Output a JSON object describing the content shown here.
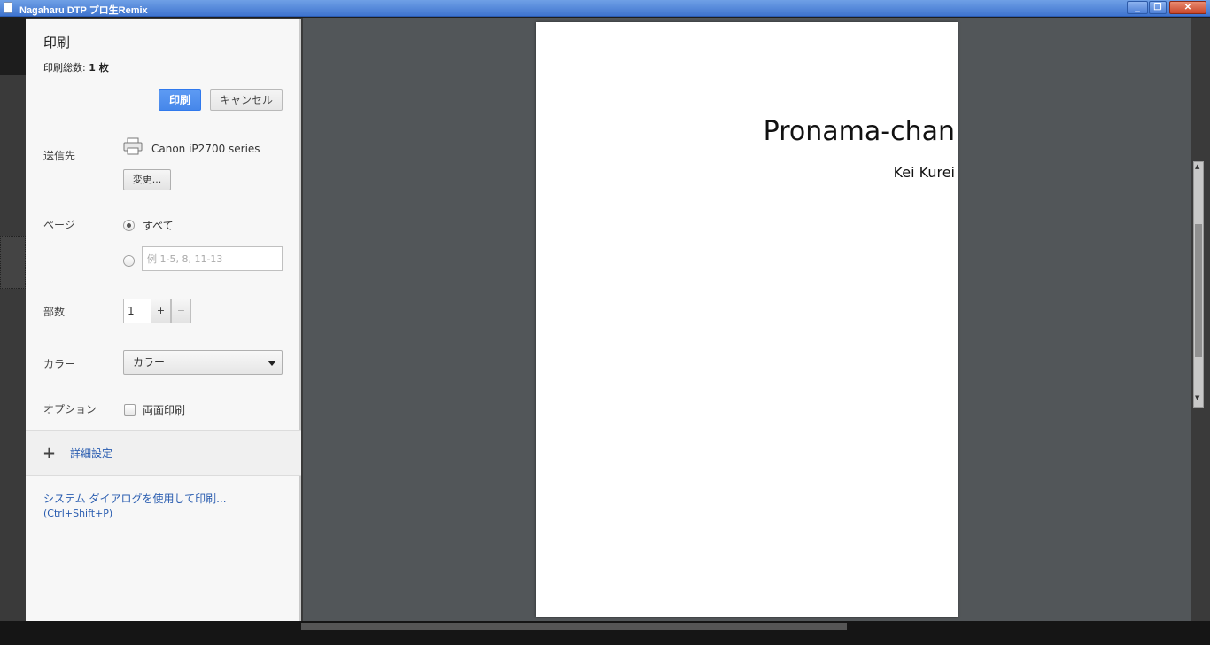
{
  "window": {
    "title": "Nagaharu DTP プロ生Remix",
    "minimize": "_",
    "restore": "❐",
    "close": "✕"
  },
  "print": {
    "title": "印刷",
    "total_label": "印刷総数:",
    "total_value": "1 枚",
    "print_button": "印刷",
    "cancel_button": "キャンセル"
  },
  "destination": {
    "label": "送信先",
    "printer_name": "Canon iP2700 series",
    "printer_icon": "printer-icon",
    "change_button": "変更..."
  },
  "pages": {
    "label": "ページ",
    "all_label": "すべて",
    "all_selected": true,
    "range_placeholder": "例 1-5, 8, 11-13"
  },
  "copies": {
    "label": "部数",
    "value": "1",
    "plus": "+",
    "minus": "−"
  },
  "color": {
    "label": "カラー",
    "selected": "カラー"
  },
  "options": {
    "label": "オプション",
    "duplex_label": "両面印刷",
    "duplex_checked": false
  },
  "advanced": {
    "icon": "+",
    "label": "詳細設定"
  },
  "system_dialog": {
    "label": "システム ダイアログを使用して印刷...",
    "shortcut": "(Ctrl+Shift+P)"
  },
  "preview": {
    "title": "Pronama-chan",
    "author": "Kei Kurei"
  },
  "colors": {
    "primary_button": "#4687ea",
    "link": "#2a5db0",
    "preview_bg": "#525659"
  }
}
